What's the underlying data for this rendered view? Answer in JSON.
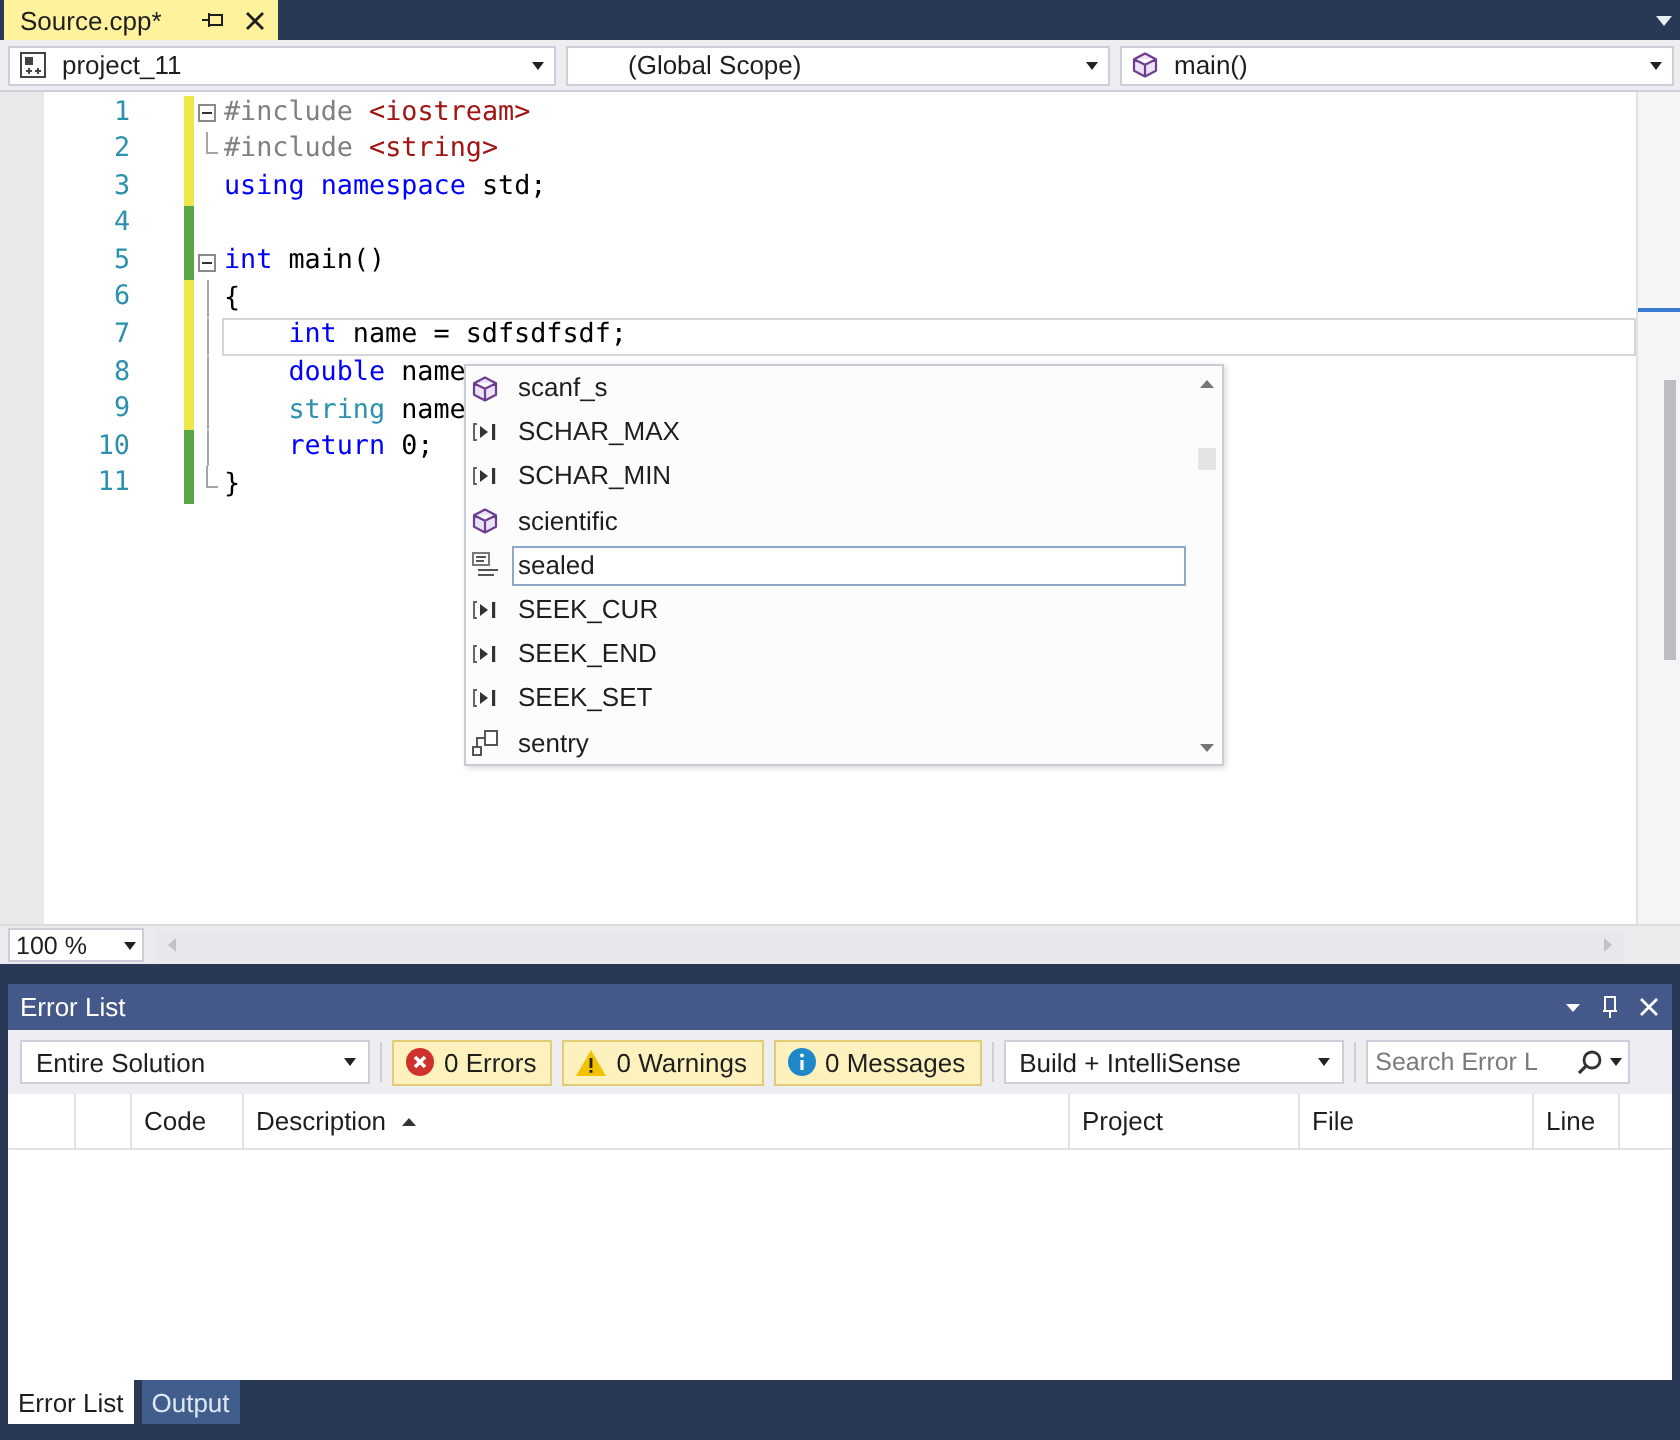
{
  "document_tabs": [
    {
      "label": "Source.cpp*",
      "selected": true
    }
  ],
  "navigation_bar": [
    {
      "kind": "project",
      "value": "project_11"
    },
    {
      "kind": "scope",
      "value": "(Global Scope)"
    },
    {
      "kind": "function",
      "value": "main()"
    }
  ],
  "editor": {
    "lines": [
      {
        "number": "1",
        "saved": false,
        "fold": {
          "kind": "toggle",
          "expanded": true
        },
        "current": false,
        "indented": false,
        "tokens": [
          {
            "kind": "preprocessor",
            "text": "#include"
          },
          {
            "kind": "include_path",
            "text": " <iostream>"
          }
        ]
      },
      {
        "number": "2",
        "saved": false,
        "fold": {
          "kind": "end"
        },
        "current": false,
        "indented": false,
        "tokens": [
          {
            "kind": "preprocessor",
            "text": "#include"
          },
          {
            "kind": "include_path",
            "text": " <string>"
          }
        ]
      },
      {
        "number": "3",
        "saved": false,
        "current": false,
        "indented": false,
        "tokens": [
          {
            "kind": "keyword",
            "text": "using"
          },
          {
            "kind": "keyword",
            "text": " namespace"
          },
          {
            "kind": "plain",
            "text": " std;"
          }
        ]
      },
      {
        "number": "4",
        "saved": true,
        "current": false
      },
      {
        "number": "5",
        "saved": true,
        "fold": {
          "kind": "toggle",
          "expanded": true
        },
        "current": false,
        "indented": false,
        "tokens": [
          {
            "kind": "keyword",
            "text": "int"
          },
          {
            "kind": "plain",
            "text": " main()"
          }
        ]
      },
      {
        "number": "6",
        "saved": false,
        "fold": {
          "kind": "guide"
        },
        "current": false,
        "indented": false,
        "tokens": [
          {
            "kind": "plain",
            "text": "{"
          }
        ]
      },
      {
        "number": "7",
        "saved": false,
        "fold": {
          "kind": "guide"
        },
        "current": true,
        "indented": true,
        "tokens": [
          {
            "kind": "keyword",
            "text": "int"
          },
          {
            "kind": "plain",
            "text": " name = sdfsdfsdf;"
          }
        ]
      },
      {
        "number": "8",
        "saved": false,
        "fold": {
          "kind": "guide"
        },
        "current": false,
        "indented": true,
        "tokens": [
          {
            "kind": "keyword",
            "text": "double"
          },
          {
            "kind": "plain",
            "text": " name"
          }
        ]
      },
      {
        "number": "9",
        "saved": false,
        "fold": {
          "kind": "guide"
        },
        "current": false,
        "indented": true,
        "tokens": [
          {
            "kind": "type",
            "text": "string"
          },
          {
            "kind": "plain",
            "text": " name"
          }
        ]
      },
      {
        "number": "10",
        "saved": true,
        "fold": {
          "kind": "guide"
        },
        "current": false,
        "indented": true,
        "tokens": [
          {
            "kind": "keyword",
            "text": "return"
          },
          {
            "kind": "plain",
            "text": " 0;"
          }
        ]
      },
      {
        "number": "11",
        "saved": true,
        "fold": {
          "kind": "end"
        },
        "current": false,
        "indented": false,
        "tokens": [
          {
            "kind": "plain",
            "text": "}"
          }
        ]
      }
    ],
    "completion": {
      "items": [
        {
          "kind": "function",
          "label": "scanf_s",
          "selected": false
        },
        {
          "kind": "macro",
          "label": "SCHAR_MAX",
          "selected": false
        },
        {
          "kind": "macro",
          "label": "SCHAR_MIN",
          "selected": false
        },
        {
          "kind": "function",
          "label": "scientific",
          "selected": false
        },
        {
          "kind": "keyword",
          "label": "sealed",
          "selected": true
        },
        {
          "kind": "macro",
          "label": "SEEK_CUR",
          "selected": false
        },
        {
          "kind": "macro",
          "label": "SEEK_END",
          "selected": false
        },
        {
          "kind": "macro",
          "label": "SEEK_SET",
          "selected": false
        },
        {
          "kind": "class",
          "label": "sentry",
          "selected": false
        }
      ]
    },
    "zoom": "100 %"
  },
  "error_list": {
    "title": "Error List",
    "scope": "Entire Solution",
    "filters": [
      {
        "kind": "error",
        "label": "0 Errors",
        "selected": true
      },
      {
        "kind": "warning",
        "label": "0 Warnings",
        "selected": true
      },
      {
        "kind": "info",
        "label": "0 Messages",
        "selected": true
      }
    ],
    "source": "Build + IntelliSense",
    "search": {
      "placeholder": "Search Error L"
    },
    "columns": [
      {
        "label": "Code",
        "sorted": false
      },
      {
        "label": "Description",
        "sorted": true
      },
      {
        "label": "Project",
        "sorted": false
      },
      {
        "label": "File",
        "sorted": false
      },
      {
        "label": "Line",
        "sorted": false
      }
    ]
  },
  "bottom_tabs": [
    {
      "label": "Error List",
      "selected": true
    },
    {
      "label": "Output",
      "selected": false
    }
  ]
}
